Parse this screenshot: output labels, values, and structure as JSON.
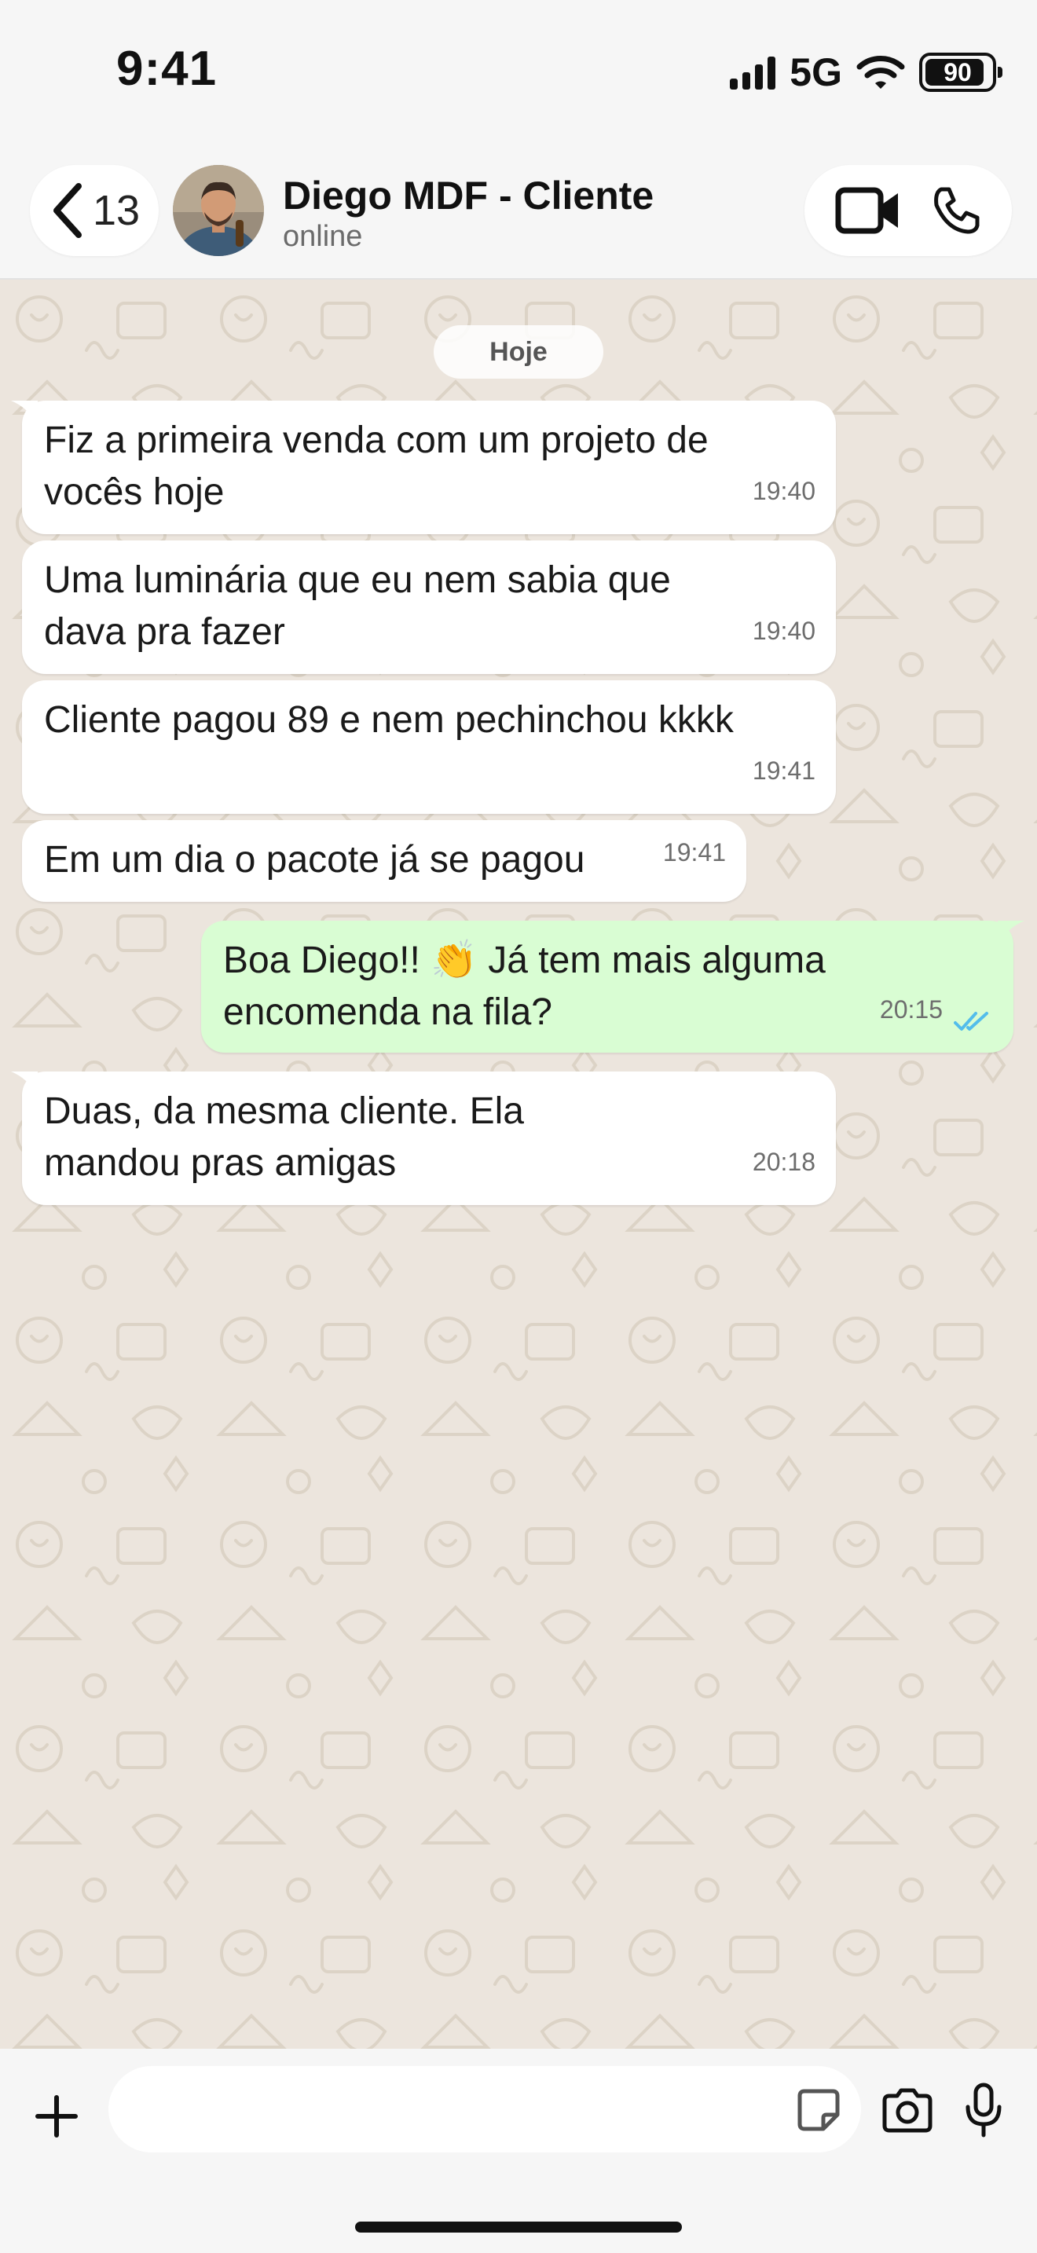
{
  "status_bar": {
    "time": "9:41",
    "network": "5G",
    "battery": "90"
  },
  "header": {
    "back_count": "13",
    "contact_name": "Diego MDF - Cliente",
    "contact_status": "online"
  },
  "chat": {
    "date_label": "Hoje",
    "messages": [
      {
        "direction": "in",
        "text": "Fiz a primeira venda com um projeto de vocês hoje",
        "time": "19:40"
      },
      {
        "direction": "in",
        "text": "Uma luminária que eu nem sabia que dava pra fazer",
        "time": "19:40"
      },
      {
        "direction": "in",
        "text": "Cliente pagou 89 e nem pechinchou kkkk",
        "time": "19:41"
      },
      {
        "direction": "in",
        "text": "Em um dia o pacote já se pagou",
        "time": "19:41"
      },
      {
        "direction": "out",
        "text": "Boa Diego!! 👏 Já tem mais alguma encomenda na fila?",
        "time": "20:15",
        "status": "read"
      },
      {
        "direction": "in",
        "text": "Duas, da mesma cliente. Ela mandou pras amigas",
        "time": "20:18"
      }
    ]
  },
  "input": {
    "placeholder": ""
  },
  "colors": {
    "incoming_bubble": "#ffffff",
    "outgoing_bubble": "#d9fdd3",
    "chat_background": "#ece5dd",
    "read_ticks": "#53bdeb"
  },
  "icons": [
    "chevron-left-icon",
    "video-call-icon",
    "phone-icon",
    "plus-icon",
    "sticker-icon",
    "camera-icon",
    "microphone-icon",
    "double-check-icon"
  ]
}
